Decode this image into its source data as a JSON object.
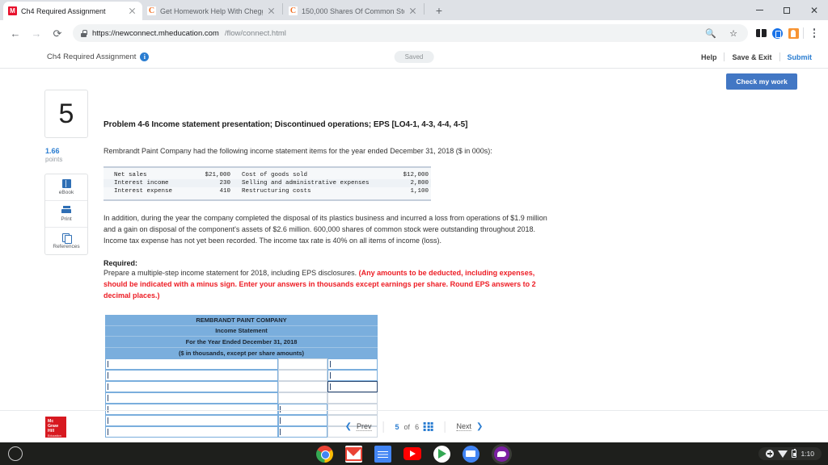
{
  "browser": {
    "tabs": [
      {
        "title": "Ch4 Required Assignment",
        "favicon": "mcgraw-hill-favicon",
        "active": true
      },
      {
        "title": "Get Homework Help With Chegg",
        "favicon": "chegg-favicon",
        "active": false
      },
      {
        "title": "150,000 Shares Of Common Sto",
        "favicon": "chegg-favicon",
        "active": false
      }
    ],
    "new_tab_label": "+",
    "window_controls": {
      "minimize": "minimize-icon",
      "maximize": "maximize-icon",
      "close": "close-icon"
    },
    "nav": {
      "back": "←",
      "forward": "→",
      "reload": "⟳"
    },
    "address": {
      "host": "https://newconnect.mheducation.com",
      "path": "/flow/connect.html",
      "lock": "lock-icon"
    },
    "omnibox_actions": [
      "zoom-icon",
      "bookmark-star-icon"
    ],
    "extensions": [
      "extension-dark-icon",
      "extension-blue-icon",
      "profile-avatar-icon"
    ],
    "menu": "chrome-menu-icon"
  },
  "app": {
    "assignment_title": "Ch4 Required Assignment",
    "info_icon_label": "i",
    "saved_badge": "Saved",
    "header_links": [
      "Help",
      "Save & Exit",
      "Submit"
    ],
    "check_my_work": "Check my work"
  },
  "question": {
    "number": "5",
    "points_value": "1.66",
    "points_label": "points",
    "tools": [
      {
        "label": "eBook",
        "icon": "ebook-icon"
      },
      {
        "label": "Print",
        "icon": "print-icon"
      },
      {
        "label": "References",
        "icon": "references-icon"
      }
    ],
    "title": "Problem 4-6 Income statement presentation; Discontinued operations; EPS [LO4-1, 4-3, 4-4, 4-5]",
    "intro": "Rembrandt Paint Company had the following income statement items for the year ended December 31, 2018 ($ in 000s):",
    "given_table": {
      "rows": [
        {
          "left_label": "Net sales",
          "left_value": "$21,000",
          "right_label": "Cost of goods sold",
          "right_value": "$12,000"
        },
        {
          "left_label": "Interest income",
          "left_value": "230",
          "right_label": "Selling and administrative expenses",
          "right_value": "2,800"
        },
        {
          "left_label": "Interest expense",
          "left_value": "410",
          "right_label": "Restructuring costs",
          "right_value": "1,100"
        }
      ]
    },
    "additional": "In addition, during the year the company completed the disposal of its plastics business and incurred a loss from operations of $1.9 million and a gain on disposal of the component's assets of $2.6 million. 600,000 shares of common stock were outstanding throughout 2018. Income tax expense has not yet been recorded. The income tax rate is 40% on all items of income (loss).",
    "required_heading": "Required:",
    "required_body": "Prepare a multiple-step income statement for 2018, including EPS disclosures. ",
    "required_red": "(Any amounts to be deducted, including expenses, should be indicated with a minus sign. Enter your answers in thousands except earnings per share. Round EPS answers to 2 decimal places.)"
  },
  "answer_table": {
    "headers": [
      "REMBRANDT PAINT COMPANY",
      "Income Statement",
      "For the Year Ended December 31, 2018",
      "($ in thousands, except per share amounts)"
    ],
    "input_rows": [
      {
        "label": "",
        "col2": "",
        "col3": ""
      },
      {
        "label": "",
        "col2": "",
        "col3": ""
      },
      {
        "label": "",
        "col2": "",
        "col3": ""
      },
      {
        "label": "",
        "col2": "",
        "col3": ""
      },
      {
        "label": "",
        "col2": "",
        "col3": ""
      },
      {
        "label": "",
        "col2": "",
        "col3": ""
      },
      {
        "label": "",
        "col2": "",
        "col3": ""
      }
    ]
  },
  "footer": {
    "logo_line1": "Mc",
    "logo_line2": "Graw",
    "logo_line3": "Hill",
    "logo_line4": "Education",
    "prev": "Prev",
    "current_page": "5",
    "of_label": "of",
    "total_pages": "6",
    "grid_icon": "grid-view-icon",
    "next": "Next"
  },
  "shelf": {
    "launcher": "launcher-icon",
    "apps": [
      {
        "name": "chrome-icon"
      },
      {
        "name": "gmail-icon"
      },
      {
        "name": "google-docs-icon"
      },
      {
        "name": "youtube-icon"
      },
      {
        "name": "play-store-icon"
      },
      {
        "name": "files-icon"
      },
      {
        "name": "chat-icon"
      }
    ],
    "tray": {
      "accessibility": "accessibility-icon",
      "wifi": "wifi-icon",
      "battery": "battery-icon",
      "time": "1:10"
    }
  },
  "colors": {
    "accent_blue": "#2a7dd1",
    "button_blue": "#4277c4",
    "table_header_blue": "#7aaedd",
    "alert_red": "#ed1c24",
    "mcgraw_red": "#d71920"
  }
}
